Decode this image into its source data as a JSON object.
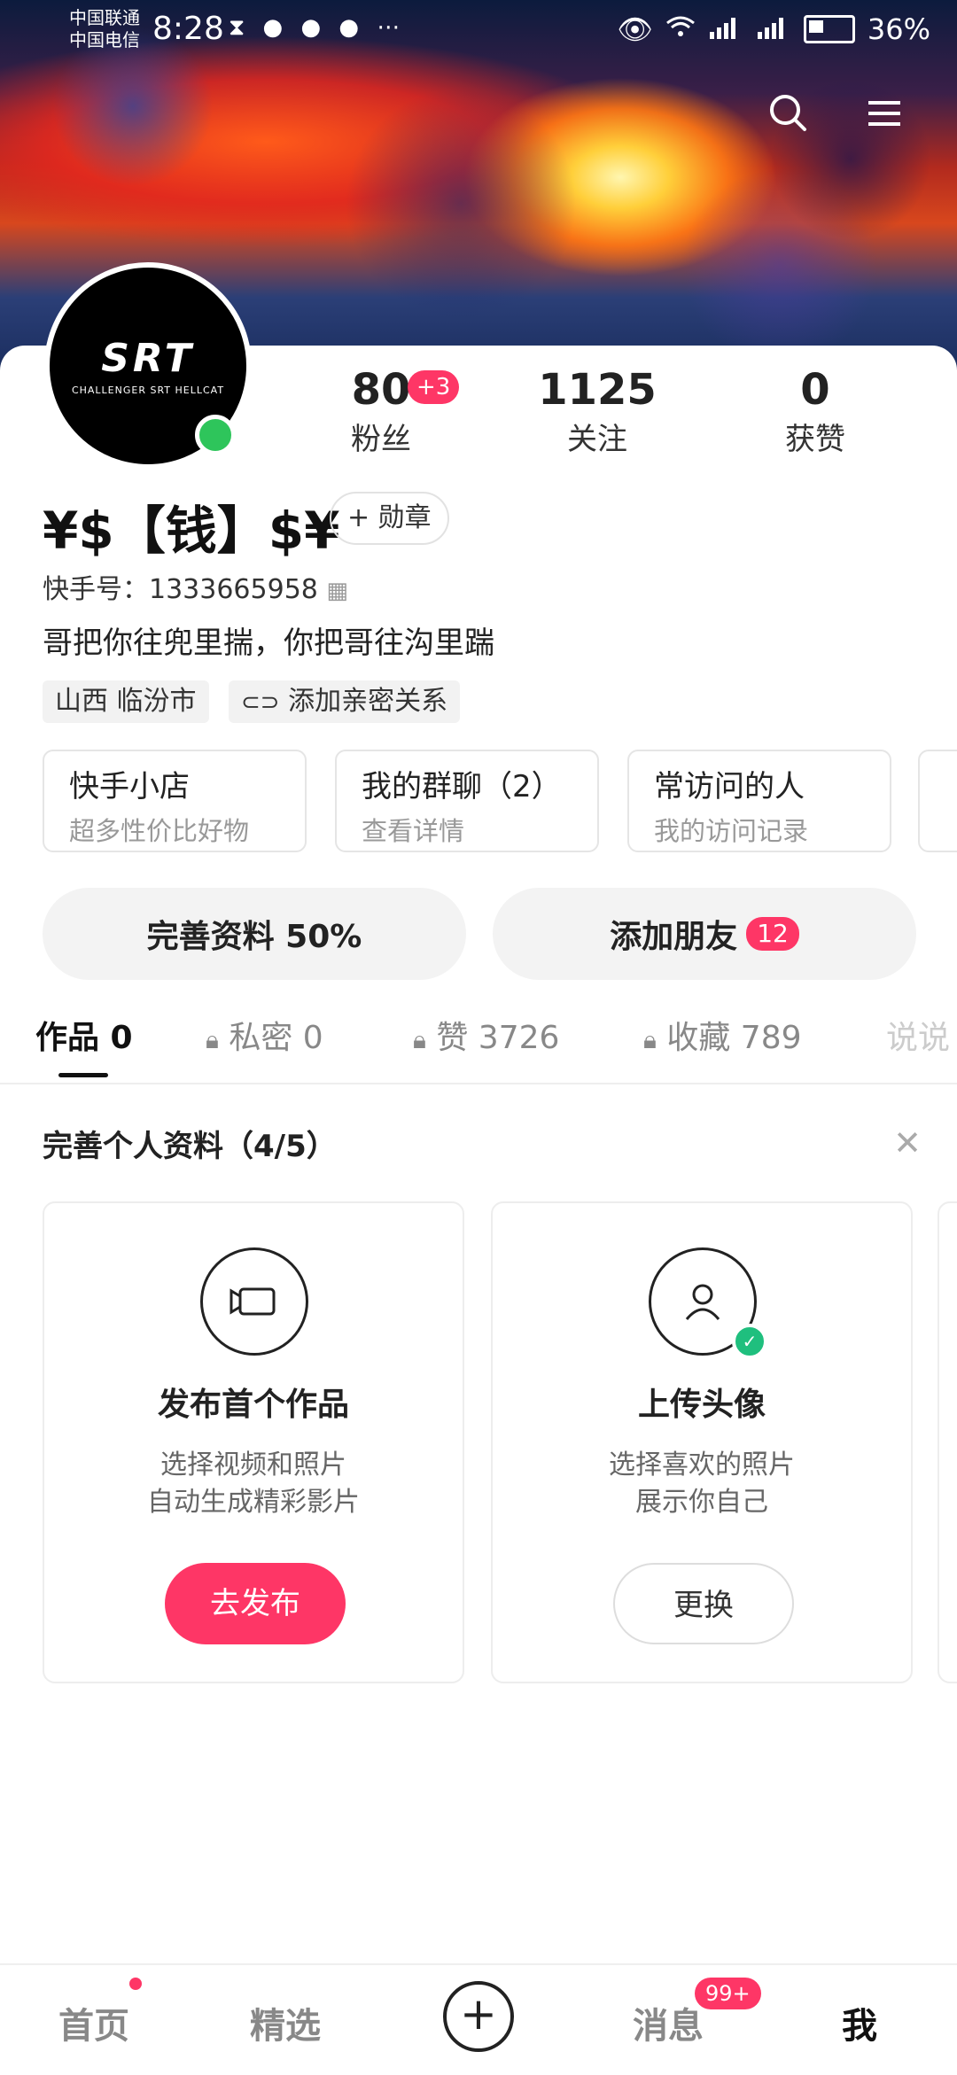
{
  "status_bar": {
    "carrier1": "中国联通",
    "carrier2": "中国电信",
    "time": "8:28",
    "battery": "36%"
  },
  "profile": {
    "avatar_text": "SRT",
    "avatar_sub": "CHALLENGER SRT HELLCAT",
    "name": "¥$【钱】$¥",
    "medal_label": "+ 勋章",
    "kuaishou_id": "快手号：1333665958",
    "bio": "哥把你往兜里揣，你把哥往沟里踹",
    "tags": [
      "山西 临汾市",
      "添加亲密关系"
    ]
  },
  "stats": {
    "fans_num": "80",
    "fans_delta": "+3",
    "fans_label": "粉丝",
    "follow_num": "1125",
    "follow_label": "关注",
    "likes_num": "0",
    "likes_label": "获赞"
  },
  "quick_entries": [
    {
      "title": "快手小店",
      "sub": "超多性价比好物"
    },
    {
      "title": "我的群聊（2）",
      "sub": "查看详情"
    },
    {
      "title": "常访问的人",
      "sub": "我的访问记录"
    }
  ],
  "actions": {
    "complete_profile": "完善资料 50%",
    "add_friend": "添加朋友",
    "add_friend_count": "12"
  },
  "tabs": [
    {
      "label": "作品 0"
    },
    {
      "label": "私密 0"
    },
    {
      "label": "赞 3726"
    },
    {
      "label": "收藏 789"
    },
    {
      "label": "说说"
    }
  ],
  "section": {
    "title": "完善个人资料（4/5）"
  },
  "tasks": [
    {
      "title": "发布首个作品",
      "desc1": "选择视频和照片",
      "desc2": "自动生成精彩影片",
      "button": "去发布"
    },
    {
      "title": "上传头像",
      "desc1": "选择喜欢的照片",
      "desc2": "展示你自己",
      "button": "更换"
    }
  ],
  "bottom_nav": {
    "home": "首页",
    "featured": "精选",
    "messages": "消息",
    "messages_badge": "99+",
    "me": "我"
  }
}
